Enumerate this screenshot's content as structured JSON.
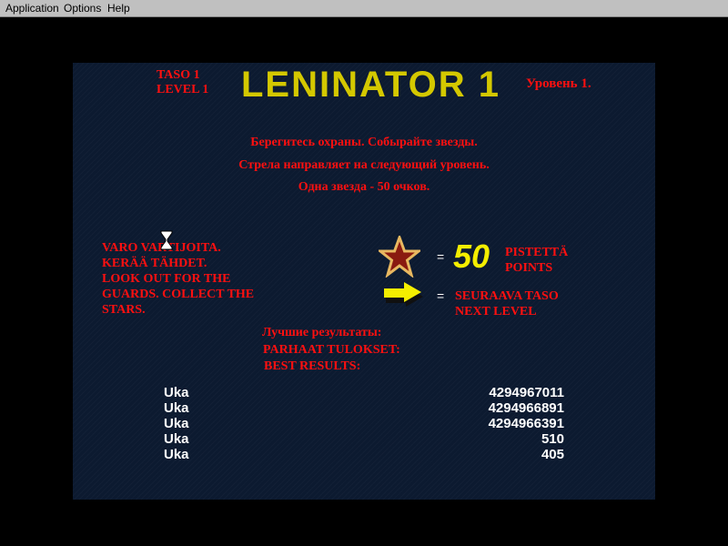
{
  "menu": {
    "items": [
      "Application",
      "Options",
      "Help"
    ]
  },
  "header": {
    "level_fi": "TASO 1",
    "level_en": "LEVEL 1",
    "title": "LENINATOR 1",
    "level_ru": "Уровень 1."
  },
  "instructions_ru": [
    "Берегитесь охраны. Собырайте звезды.",
    "Стрела направляет на следующий уровень.",
    "Одна звезда - 50 очков."
  ],
  "instructions_fi_en": [
    "VARO VARTIJOITA.",
    "KERÄÄ TÄHDET.",
    "LOOK OUT FOR THE",
    "GUARDS. COLLECT THE",
    "STARS."
  ],
  "legend": {
    "equals": "=",
    "star_points": "50",
    "star_label_fi": "PISTETTÄ",
    "star_label_en": "POINTS",
    "arrow_label_fi": "SEURAAVA TASO",
    "arrow_label_en": "NEXT LEVEL"
  },
  "best": {
    "ru": "Лучшие результаты:",
    "fi": "PARHAAT TULOKSET:",
    "en": "BEST RESULTS:"
  },
  "scores": [
    {
      "name": "Uka",
      "score": "4294967011"
    },
    {
      "name": "Uka",
      "score": "4294966891"
    },
    {
      "name": "Uka",
      "score": "4294966391"
    },
    {
      "name": "Uka",
      "score": "510"
    },
    {
      "name": "Uka",
      "score": "405"
    }
  ],
  "colors": {
    "panel": "#0c1a30",
    "text": "#ff1010",
    "title": "#d4c800"
  }
}
